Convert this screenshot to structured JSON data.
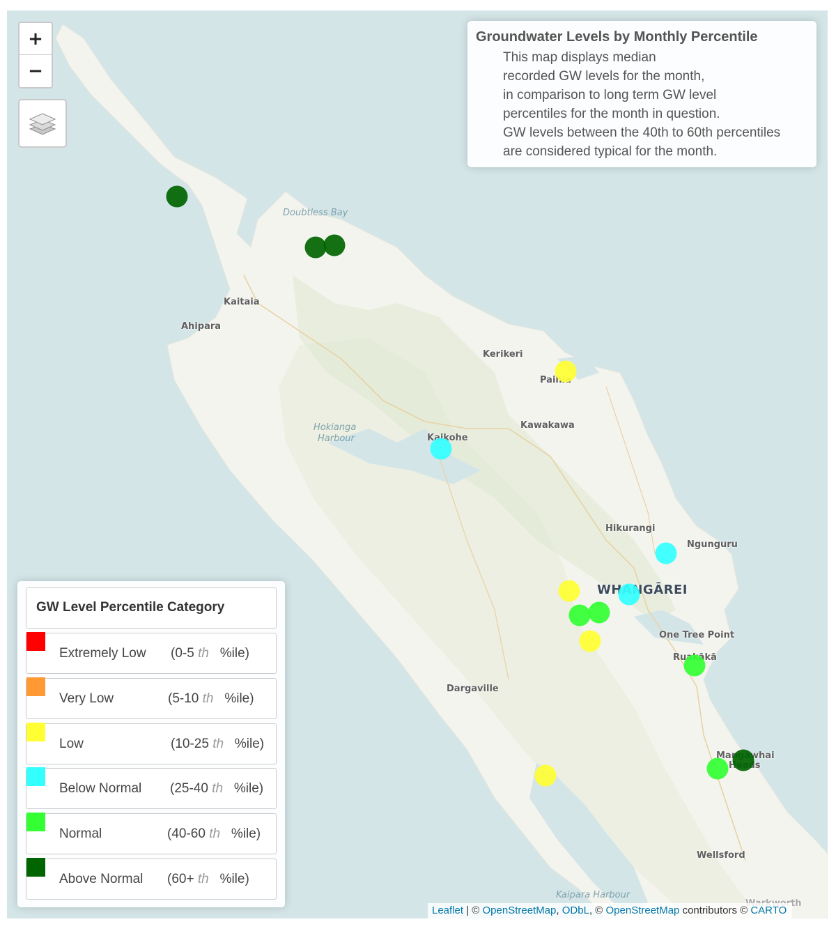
{
  "map": {
    "places": {
      "kaitaia": "Kaitaia",
      "ahipara": "Ahipara",
      "kerikeri": "Kerikeri",
      "paihia": "Paihia",
      "kawakawa": "Kawakawa",
      "kaikohe": "Kaikohe",
      "hikurangi": "Hikurangi",
      "ngunguru": "Ngunguru",
      "whangarei": "WHANGĀREI",
      "one_tree_point": "One Tree Point",
      "ruakaka": "Ruakākā",
      "dargaville": "Dargaville",
      "mangawhai": "Mangawhai",
      "heads": "Heads",
      "wellsford": "Wellsford",
      "warkworth": "Warkworth"
    },
    "water": {
      "doubtless_bay": "Doubtless Bay",
      "hokianga_1": "Hokianga",
      "hokianga_2": "Harbour",
      "kaipara": "Kaipara Harbour"
    },
    "markers": [
      {
        "site": "north-west-coast",
        "category": "Above Normal",
        "color": "#006400"
      },
      {
        "site": "doubtless-bay-1",
        "category": "Above Normal",
        "color": "#006400"
      },
      {
        "site": "doubtless-bay-2",
        "category": "Above Normal",
        "color": "#006400"
      },
      {
        "site": "paihia",
        "category": "Low",
        "color": "#ffff33"
      },
      {
        "site": "kaikohe",
        "category": "Below Normal",
        "color": "#33ffff"
      },
      {
        "site": "ngunguru",
        "category": "Below Normal",
        "color": "#33ffff"
      },
      {
        "site": "whangarei-west",
        "category": "Low",
        "color": "#ffff33"
      },
      {
        "site": "whangarei",
        "category": "Below Normal",
        "color": "#33ffff"
      },
      {
        "site": "whangarei-sw-1",
        "category": "Normal",
        "color": "#33ff33"
      },
      {
        "site": "whangarei-sw-2",
        "category": "Normal",
        "color": "#33ff33"
      },
      {
        "site": "whangarei-south",
        "category": "Low",
        "color": "#ffff33"
      },
      {
        "site": "ruakaka",
        "category": "Normal",
        "color": "#33ff33"
      },
      {
        "site": "kaipara-north",
        "category": "Low",
        "color": "#ffff33"
      },
      {
        "site": "mangawhai-1",
        "category": "Normal",
        "color": "#33ff33"
      },
      {
        "site": "mangawhai-2",
        "category": "Above Normal",
        "color": "#006400"
      }
    ]
  },
  "controls": {
    "zoom_in": "+",
    "zoom_out": "−",
    "layers_icon": "layers-icon"
  },
  "info": {
    "title": "Groundwater Levels by Monthly Percentile",
    "lines": [
      "This map displays median",
      "recorded GW levels for the month,",
      "in comparison to long term GW level",
      "percentiles for the month in question.",
      "GW levels between the 40th to 60th percentiles",
      "are considered typical for the month."
    ]
  },
  "legend": {
    "title": "GW Level Percentile Category",
    "items": [
      {
        "name": "Extremely Low",
        "range_open": "(0-5",
        "th": "th",
        "range_close": "%ile)",
        "color": "#ff0000"
      },
      {
        "name": "Very Low",
        "range_open": "(5-10",
        "th": "th",
        "range_close": "%ile)",
        "color": "#ff9933"
      },
      {
        "name": "Low",
        "range_open": "(10-25",
        "th": "th",
        "range_close": "%ile)",
        "color": "#ffff33"
      },
      {
        "name": "Below Normal",
        "range_open": "(25-40",
        "th": "th",
        "range_close": "%ile)",
        "color": "#33ffff"
      },
      {
        "name": "Normal",
        "range_open": "(40-60",
        "th": "th",
        "range_close": "%ile)",
        "color": "#33ff33"
      },
      {
        "name": "Above Normal",
        "range_open": "(60+",
        "th": "th",
        "range_close": "%ile)",
        "color": "#006400"
      }
    ]
  },
  "attribution": {
    "leaflet": "Leaflet",
    "sep1": " | © ",
    "osm1": "OpenStreetMap",
    "comma": ", ",
    "odbl": "ODbL",
    "sep2": ", © ",
    "osm2": "OpenStreetMap",
    "contributors": " contributors © ",
    "carto": "CARTO"
  }
}
